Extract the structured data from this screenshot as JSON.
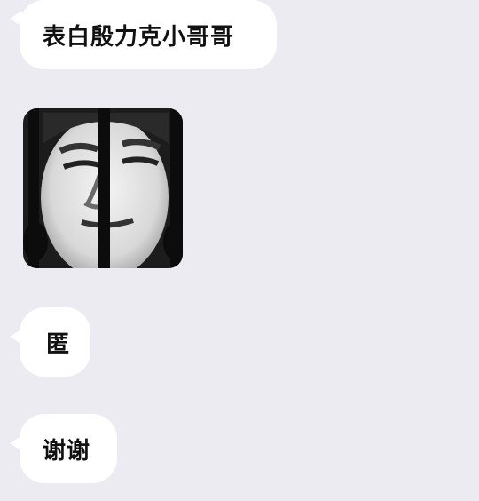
{
  "messages": [
    {
      "type": "text",
      "text": "表白殷力克小哥哥"
    },
    {
      "type": "sticker",
      "icon": "jail-bars-face-sticker"
    },
    {
      "type": "text",
      "text": "匿"
    },
    {
      "type": "text",
      "text": "谢谢"
    }
  ],
  "colors": {
    "background": "#ebebf1",
    "bubble": "#ffffff",
    "text": "#111111"
  }
}
